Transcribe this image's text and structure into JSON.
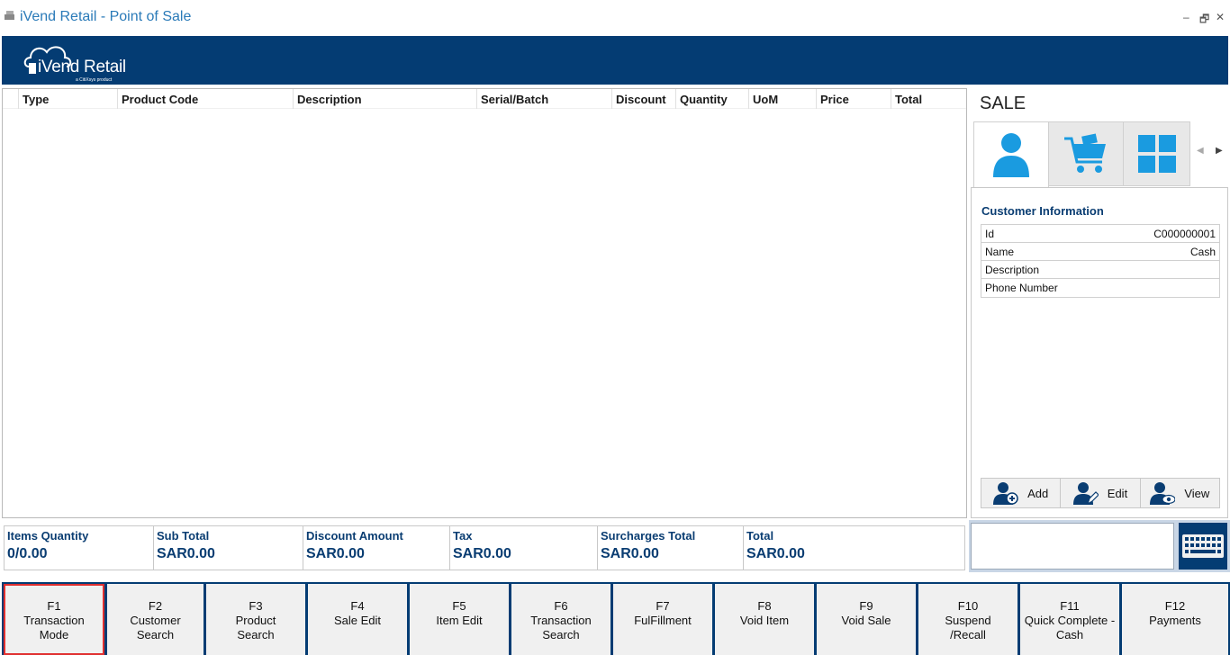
{
  "window": {
    "title": "iVend Retail - Point of Sale",
    "minimize": "–",
    "restore": "🗗"
  },
  "header": {
    "logo_text": "iVend Retail",
    "logo_sub": "a CitiXsys product"
  },
  "grid": {
    "columns": [
      "Type",
      "Product Code",
      "Description",
      "Serial/Batch",
      "Discount",
      "Quantity",
      "UoM",
      "Price",
      "Total"
    ]
  },
  "right_panel": {
    "title": "SALE",
    "tabs": [
      "customer-icon",
      "cart-icon",
      "grid-icon"
    ],
    "customer_info_title": "Customer Information",
    "rows": [
      {
        "label": "Id",
        "value": "C000000001"
      },
      {
        "label": "Name",
        "value": "Cash"
      },
      {
        "label": "Description",
        "value": ""
      },
      {
        "label": "Phone Number",
        "value": ""
      }
    ],
    "actions": [
      "Add",
      "Edit",
      "View"
    ]
  },
  "totals": [
    {
      "label": "Items Quantity",
      "value": "0/0.00"
    },
    {
      "label": "Sub Total",
      "value": "SAR0.00"
    },
    {
      "label": "Discount Amount",
      "value": "SAR0.00"
    },
    {
      "label": "Tax",
      "value": "SAR0.00"
    },
    {
      "label": "Surcharges Total",
      "value": "SAR0.00"
    },
    {
      "label": "Total",
      "value": "SAR0.00"
    }
  ],
  "fkeys": [
    {
      "key": "F1",
      "line1": "Transaction",
      "line2": "Mode"
    },
    {
      "key": "F2",
      "line1": "Customer",
      "line2": "Search"
    },
    {
      "key": "F3",
      "line1": "Product",
      "line2": "Search"
    },
    {
      "key": "F4",
      "line1": "Sale Edit",
      "line2": ""
    },
    {
      "key": "F5",
      "line1": "Item Edit",
      "line2": ""
    },
    {
      "key": "F6",
      "line1": "Transaction",
      "line2": "Search"
    },
    {
      "key": "F7",
      "line1": "FulFillment",
      "line2": ""
    },
    {
      "key": "F8",
      "line1": "Void Item",
      "line2": ""
    },
    {
      "key": "F9",
      "line1": "Void Sale",
      "line2": ""
    },
    {
      "key": "F10",
      "line1": "Suspend",
      "line2": "/Recall"
    },
    {
      "key": "F11",
      "line1": "Quick Complete -",
      "line2": "Cash"
    },
    {
      "key": "F12",
      "line1": "Payments",
      "line2": ""
    }
  ],
  "colors": {
    "brand_navy": "#043c73",
    "label_blue": "#0a3d72",
    "icon_blue": "#1a9be0",
    "selected_outline": "#e03030"
  }
}
